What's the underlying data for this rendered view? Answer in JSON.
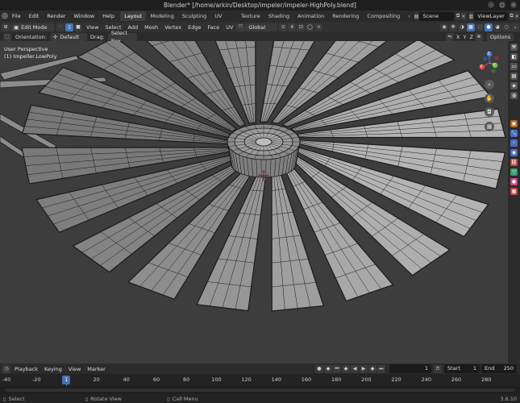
{
  "window": {
    "title": "Blender* [/home/arkin/Desktop/impeler/impeler-HighPoly.blend]"
  },
  "topbar": {
    "menus": [
      "File",
      "Edit",
      "Render",
      "Window",
      "Help"
    ],
    "workspaces": [
      "Layout",
      "Modeling",
      "Sculpting",
      "UV Editing",
      "Texture Paint",
      "Shading",
      "Animation",
      "Rendering",
      "Compositing"
    ],
    "active_workspace": "Layout",
    "scene": "Scene",
    "view_layer": "ViewLayer"
  },
  "header": {
    "mode": "Edit Mode",
    "menus": [
      "View",
      "Select",
      "Add",
      "Mesh",
      "Vertex",
      "Edge",
      "Face",
      "UV"
    ],
    "transform_orientation": "Global",
    "axes": [
      "X",
      "Y",
      "Z"
    ]
  },
  "tool_settings": {
    "orientation_label": "Orientation:",
    "orientation_value": "Default",
    "drag_label": "Drag:",
    "drag_value": "Select Box",
    "options_label": "Options"
  },
  "viewport": {
    "perspective": "User Perspective",
    "object": "(1) Impeller.LowPoly",
    "blade_count": 20,
    "colors": {
      "background": "#3d3d3d",
      "mesh_fill": "#9a9a9a",
      "wire": "#1a1a1a"
    }
  },
  "gizmo": {
    "x": "X",
    "y": "Y",
    "z": "Z"
  },
  "timeline": {
    "menus": [
      "Playback",
      "Keying",
      "View",
      "Marker"
    ],
    "current_frame": "1",
    "start_label": "Start",
    "start": "1",
    "end_label": "End",
    "end": "250",
    "ticks": [
      "-40",
      "-20",
      "1",
      "20",
      "40",
      "60",
      "80",
      "100",
      "120",
      "140",
      "160",
      "180",
      "200",
      "220",
      "240",
      "260",
      "280"
    ]
  },
  "status": {
    "select": "Select",
    "rotate": "Rotate View",
    "call_menu": "Call Menu",
    "version": "3.6.10"
  }
}
